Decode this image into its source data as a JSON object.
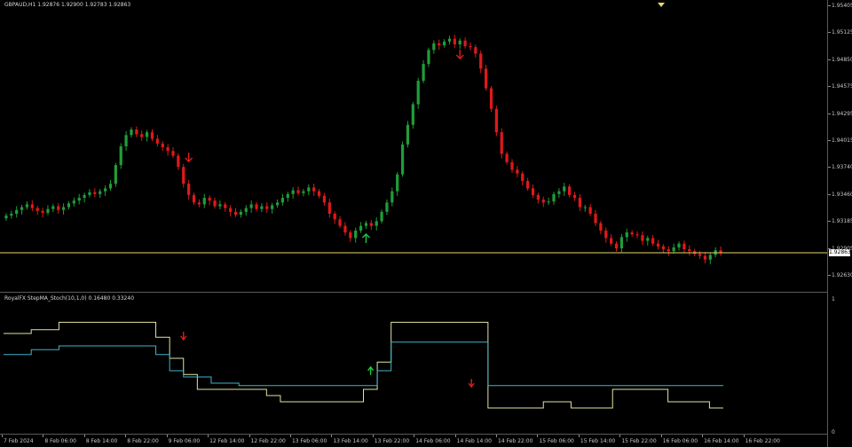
{
  "chart": {
    "title": "GBPAUD,H1  1.92876 1.92900 1.92783 1.92863",
    "current_price": "1.92863",
    "price_axis_labels": [
      "1.95405",
      "1.95125",
      "1.94850",
      "1.94575",
      "1.94295",
      "1.94015",
      "1.93740",
      "1.93460",
      "1.93185",
      "1.92905",
      "1.92630"
    ],
    "colors": {
      "bull": "#1f9d3a",
      "bear": "#e01919",
      "current_line": "#e8d66b",
      "signal_up": "#20c640",
      "signal_down": "#e11b1b"
    }
  },
  "indicator": {
    "title": "RoyalFX StepMA_Stoch(10,1,0) 0.16480 0.33240",
    "axis_top": "1",
    "axis_bottom": "0",
    "colors": {
      "fast": "#e6e2a0",
      "slow": "#3fb3c8"
    }
  },
  "time_axis_labels": [
    "7 Feb 2024",
    "8 Feb 06:00",
    "8 Feb 14:00",
    "8 Feb 22:00",
    "9 Feb 06:00",
    "12 Feb 14:00",
    "12 Feb 22:00",
    "13 Feb 06:00",
    "13 Feb 14:00",
    "13 Feb 22:00",
    "14 Feb 06:00",
    "14 Feb 14:00",
    "14 Feb 22:00",
    "15 Feb 06:00",
    "15 Feb 14:00",
    "15 Feb 22:00",
    "16 Feb 06:00",
    "16 Feb 14:00",
    "16 Feb 22:00",
    "14 Feb 06:00",
    "14 Feb 14:00",
    "14 Feb 22:00",
    "15 Feb 06:00",
    "15 Feb 14:00",
    "15 Feb 22:00",
    "16 Feb 06:00",
    "16 Feb 22:00"
  ],
  "chart_data": {
    "type": "candlestick",
    "symbol": "GBPAUD",
    "timeframe": "H1",
    "ylim": [
      1.9255,
      1.9545
    ],
    "current_price": 1.92863,
    "closes": [
      1.9326,
      1.9328,
      1.9332,
      1.9335,
      1.9338,
      1.9334,
      1.9331,
      1.9329,
      1.9333,
      1.9336,
      1.9332,
      1.9335,
      1.9339,
      1.9342,
      1.9345,
      1.9348,
      1.9351,
      1.9349,
      1.9352,
      1.9355,
      1.936,
      1.938,
      1.94,
      1.9412,
      1.9418,
      1.9413,
      1.941,
      1.9415,
      1.9408,
      1.9403,
      1.9399,
      1.9395,
      1.939,
      1.9378,
      1.936,
      1.9348,
      1.934,
      1.9338,
      1.9345,
      1.9342,
      1.9336,
      1.9338,
      1.9334,
      1.933,
      1.9327,
      1.933,
      1.9334,
      1.9338,
      1.9333,
      1.9336,
      1.9333,
      1.9337,
      1.934,
      1.9345,
      1.9349,
      1.9353,
      1.935,
      1.9352,
      1.9356,
      1.9352,
      1.9347,
      1.934,
      1.9328,
      1.9322,
      1.9315,
      1.9308,
      1.9302,
      1.931,
      1.9315,
      1.9318,
      1.9315,
      1.932,
      1.933,
      1.934,
      1.9352,
      1.937,
      1.9402,
      1.9423,
      1.9445,
      1.947,
      1.9488,
      1.9503,
      1.951,
      1.9508,
      1.9512,
      1.9515,
      1.9509,
      1.9513,
      1.9507,
      1.9506,
      1.9499,
      1.9483,
      1.9462,
      1.944,
      1.9415,
      1.9392,
      1.9383,
      1.9375,
      1.9371,
      1.9363,
      1.9355,
      1.9348,
      1.9343,
      1.934,
      1.9341,
      1.9349,
      1.9352,
      1.9357,
      1.9348,
      1.9345,
      1.9335,
      1.9335,
      1.9328,
      1.9318,
      1.931,
      1.9302,
      1.9296,
      1.9291,
      1.9303,
      1.9308,
      1.9306,
      1.9305,
      1.9299,
      1.9302,
      1.9296,
      1.9293,
      1.929,
      1.9288,
      1.9292,
      1.9296,
      1.929,
      1.9288,
      1.9285,
      1.9283,
      1.9279,
      1.9284,
      1.9289,
      1.9286
    ],
    "indicator_series": [
      {
        "name": "fast",
        "values": [
          0.75,
          0.75,
          0.78,
          0.78,
          0.84,
          0.84,
          0.84,
          0.84,
          0.84,
          0.84,
          0.84,
          0.72,
          0.55,
          0.42,
          0.3,
          0.3,
          0.3,
          0.3,
          0.3,
          0.25,
          0.2,
          0.2,
          0.2,
          0.2,
          0.2,
          0.2,
          0.3,
          0.52,
          0.84,
          0.84,
          0.84,
          0.84,
          0.84,
          0.84,
          0.84,
          0.15,
          0.15,
          0.15,
          0.15,
          0.2,
          0.2,
          0.15,
          0.15,
          0.15,
          0.3,
          0.3,
          0.3,
          0.3,
          0.2,
          0.2,
          0.2,
          0.15,
          0.15
        ]
      },
      {
        "name": "slow",
        "values": [
          0.58,
          0.58,
          0.62,
          0.62,
          0.65,
          0.65,
          0.65,
          0.65,
          0.65,
          0.65,
          0.65,
          0.58,
          0.45,
          0.4,
          0.4,
          0.35,
          0.35,
          0.33,
          0.33,
          0.33,
          0.33,
          0.33,
          0.33,
          0.33,
          0.33,
          0.33,
          0.33,
          0.45,
          0.68,
          0.68,
          0.68,
          0.68,
          0.68,
          0.68,
          0.68,
          0.33,
          0.33,
          0.33,
          0.33,
          0.33,
          0.33,
          0.33,
          0.33,
          0.33,
          0.33,
          0.33,
          0.33,
          0.33,
          0.33,
          0.33,
          0.33,
          0.33,
          0.33
        ]
      }
    ],
    "signals": [
      {
        "type": "sell",
        "price": 1.938
      },
      {
        "type": "buy",
        "price": 1.931
      },
      {
        "type": "sell",
        "price": 1.949
      }
    ],
    "indicator_signals": [
      {
        "type": "sell",
        "value": 0.7
      },
      {
        "type": "buy",
        "value": 0.48
      },
      {
        "type": "sell",
        "value": 0.32
      }
    ]
  }
}
